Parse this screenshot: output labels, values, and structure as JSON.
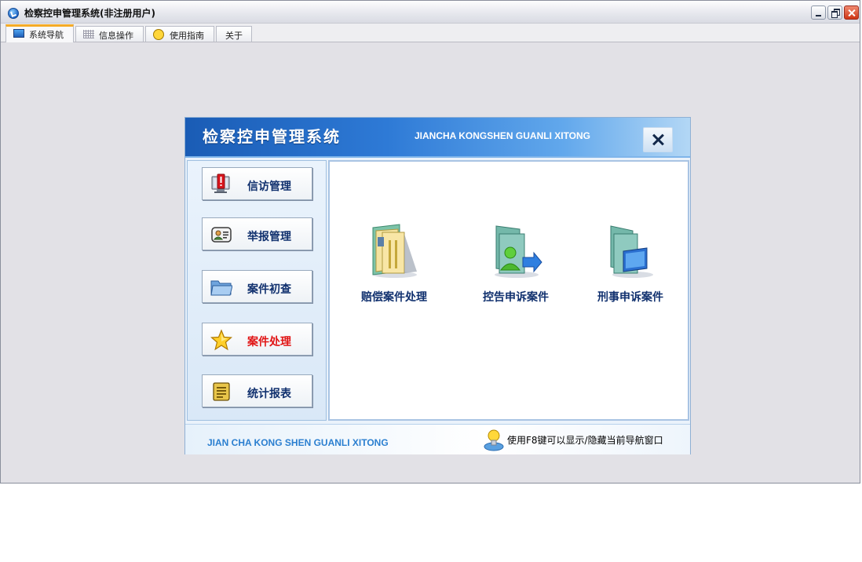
{
  "window": {
    "title": "检察控申管理系统(非注册用户)",
    "icon": "app-logo-icon",
    "controls": [
      "minimize-icon",
      "restore-icon",
      "close-icon"
    ]
  },
  "tabs": [
    {
      "label": "系统导航",
      "icon": "monitor-icon",
      "active": true
    },
    {
      "label": "信息操作",
      "icon": "grid-icon",
      "active": false
    },
    {
      "label": "使用指南",
      "icon": "smiley-icon",
      "active": false
    },
    {
      "label": "关于",
      "icon": "",
      "active": false
    }
  ],
  "dialog": {
    "title": "检察控申管理系统",
    "subtitle": "JIANCHA KONGSHEN GUANLI XITONG",
    "close_icon": "close-icon",
    "side_buttons": [
      {
        "label": "信访管理",
        "icon": "alert-monitor-icon",
        "active": false
      },
      {
        "label": "举报管理",
        "icon": "contact-card-icon",
        "active": false
      },
      {
        "label": "案件初查",
        "icon": "folder-icon",
        "active": false
      },
      {
        "label": "案件处理",
        "icon": "star-icon",
        "active": true
      },
      {
        "label": "统计报表",
        "icon": "scroll-report-icon",
        "active": false
      }
    ],
    "content_items": [
      {
        "label": "赔偿案件处理",
        "icon": "document-folder-icon"
      },
      {
        "label": "控告申诉案件",
        "icon": "user-folder-icon"
      },
      {
        "label": "刑事申诉案件",
        "icon": "monitor-folder-icon"
      }
    ],
    "footer": {
      "brand": "JIAN CHA KONG SHEN GUANLI XITONG",
      "hint_icon": "lightbulb-icon",
      "hint": "使用F8键可以显示/隐藏当前导航窗口"
    }
  },
  "colors": {
    "header_blue": "#1a5cb5",
    "label_navy": "#10306e",
    "active_red": "#e11414",
    "tab_accent": "#f5ab26"
  }
}
